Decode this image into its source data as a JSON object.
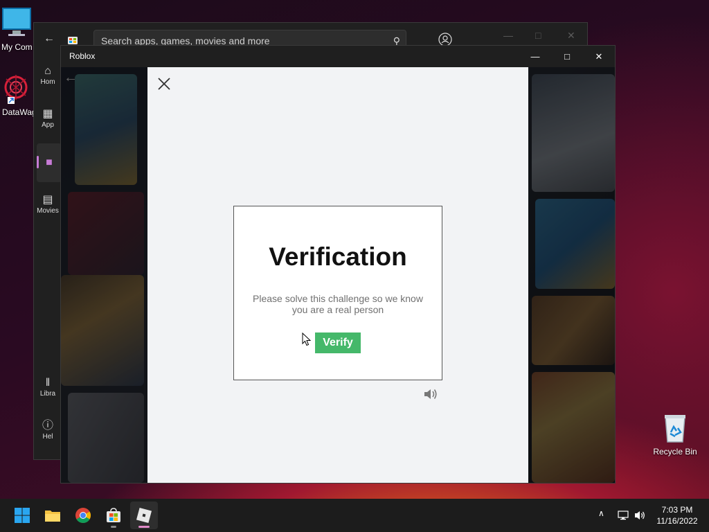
{
  "desktop": {
    "icons": [
      {
        "label": "My Com"
      },
      {
        "label": "DataWag"
      },
      {
        "label": "Recycle Bin"
      }
    ]
  },
  "store": {
    "search_placeholder": "Search apps, games, movies and more",
    "sidebar": [
      {
        "label": "Hom"
      },
      {
        "label": "App"
      },
      {
        "label": ""
      },
      {
        "label": "Movies"
      },
      {
        "label": "Libra"
      },
      {
        "label": "Hel"
      }
    ]
  },
  "roblox": {
    "title": "Roblox"
  },
  "challenge": {
    "title": "Verification",
    "text": "Please solve this challenge so we know you are a real person",
    "verify_label": "Verify"
  },
  "taskbar": {
    "time": "7:03 PM",
    "date": "11/16/2022"
  },
  "colors": {
    "verify_button": "#45b86a",
    "modal_bg": "#f2f3f5",
    "active_indicator": "#c77bd6"
  }
}
